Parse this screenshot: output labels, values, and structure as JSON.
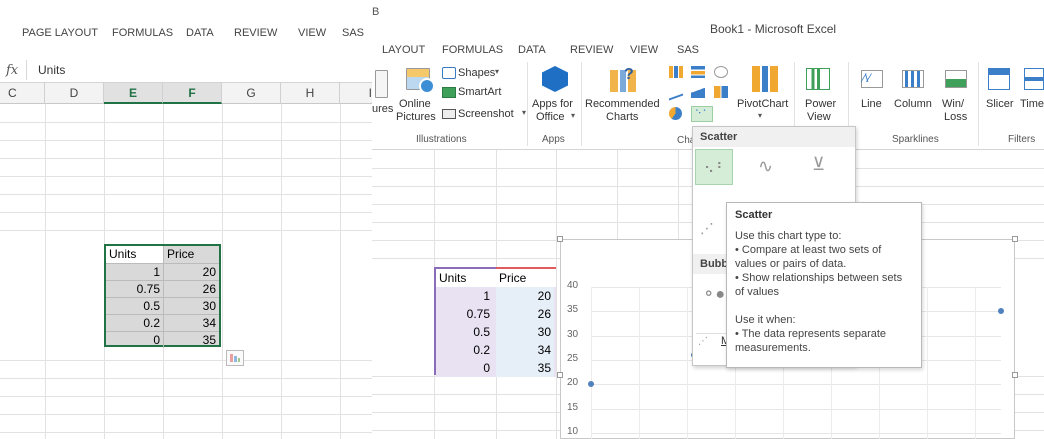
{
  "left": {
    "tabs": [
      "PAGE LAYOUT",
      "FORMULAS",
      "DATA",
      "REVIEW",
      "VIEW",
      "SAS"
    ],
    "fx_symbol": "fx",
    "formula_value": "Units",
    "columns": [
      "C",
      "D",
      "E",
      "F",
      "G",
      "H",
      "I"
    ],
    "table": {
      "headers": [
        "Units",
        "Price"
      ],
      "rows": [
        [
          "1",
          "20"
        ],
        [
          "0.75",
          "26"
        ],
        [
          "0.5",
          "30"
        ],
        [
          "0.2",
          "34"
        ],
        [
          "0",
          "35"
        ]
      ]
    }
  },
  "right": {
    "window_title": "Book1 - Microsoft Excel",
    "tabs": [
      "LAYOUT",
      "FORMULAS",
      "DATA",
      "REVIEW",
      "VIEW",
      "SAS"
    ],
    "partial_tab": "B",
    "ribbon": {
      "pictures_cut": "ures",
      "online_pictures": "Online",
      "online_pictures2": "Pictures",
      "shapes": "Shapes",
      "smartart": "SmartArt",
      "screenshot": "Screenshot",
      "illustrations_group": "Illustrations",
      "apps_for_office": "Apps for",
      "apps_for_office2": "Office",
      "apps_group": "Apps",
      "recommended_charts": "Recommended",
      "recommended_charts2": "Charts",
      "charts_group_cut": "Char",
      "pivotchart": "PivotChart",
      "power_view": "Power",
      "power_view2": "View",
      "line": "Line",
      "column": "Column",
      "winloss": "Win/",
      "winloss2": "Loss",
      "sparklines_group": "Sparklines",
      "slicer": "Slicer",
      "timeline_cut": "Time",
      "filters_group": "Filters"
    },
    "table": {
      "headers": [
        "Units",
        "Price"
      ],
      "rows": [
        [
          "1",
          "20"
        ],
        [
          "0.75",
          "26"
        ],
        [
          "0.5",
          "30"
        ],
        [
          "0.2",
          "34"
        ],
        [
          "0",
          "35"
        ]
      ]
    },
    "chart": {
      "y_ticks": [
        "40",
        "35",
        "30",
        "25",
        "20",
        "15",
        "10"
      ]
    },
    "dropdown": {
      "scatter_heading": "Scatter",
      "bubble_heading_cut": "Bubb",
      "more_cut": "M"
    },
    "tooltip": {
      "title": "Scatter",
      "lines": [
        "Use this chart type to:",
        "• Compare at least two sets of",
        "values or pairs of data.",
        "• Show relationships between sets",
        "of values",
        "",
        "Use it when:",
        "• The data represents separate",
        "measurements."
      ]
    }
  },
  "chart_data": {
    "type": "scatter",
    "x": [
      1,
      0.75,
      0.5,
      0.2,
      0
    ],
    "y": [
      20,
      26,
      30,
      34,
      35
    ],
    "y_ticks": [
      40,
      35,
      30,
      25,
      20,
      15,
      10
    ],
    "ylim": [
      10,
      40
    ],
    "grid": true,
    "series_color": "#4f81bd"
  },
  "colors": {
    "excel_green": "#217346",
    "selection_fill": "#d9d9d9",
    "units_border": "#8a6cb8",
    "price_border": "#7fa7d9",
    "price_header_border": "#e05b5b"
  }
}
